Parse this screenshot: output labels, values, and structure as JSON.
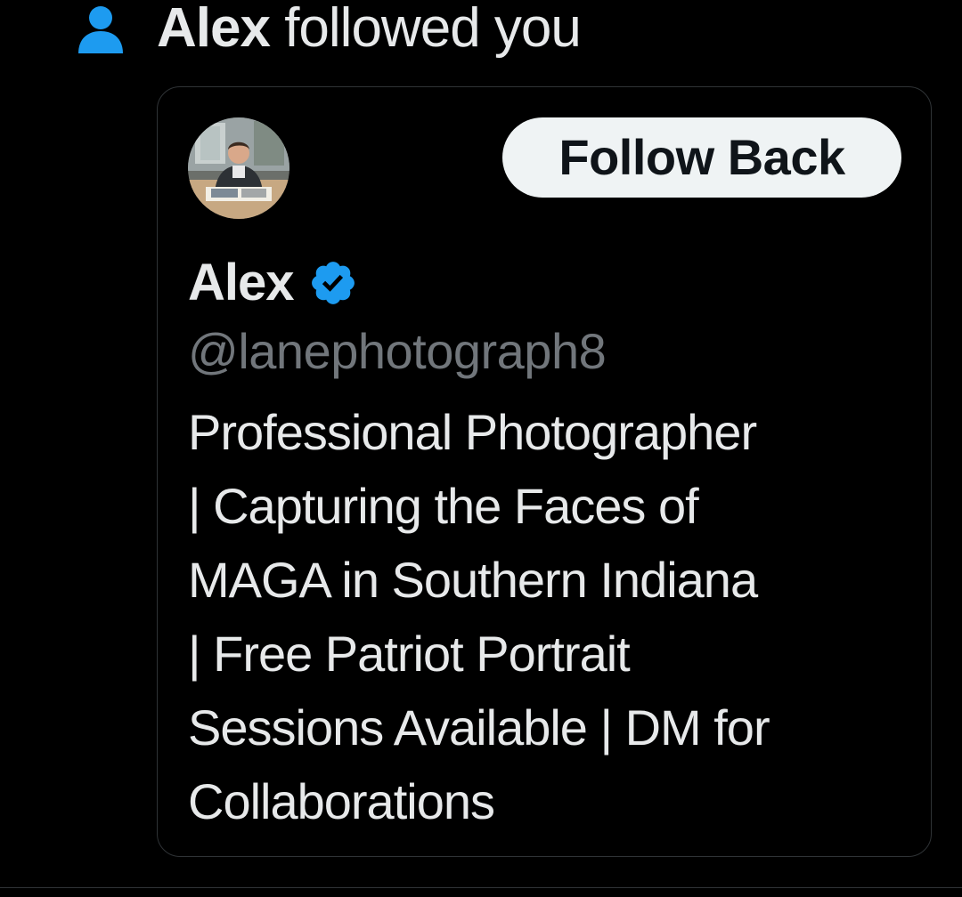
{
  "notification": {
    "icon": "person-icon",
    "actor_name": "Alex",
    "action_text": " followed you"
  },
  "card": {
    "avatar": "profile-photo",
    "follow_back_label": "Follow Back",
    "display_name": "Alex",
    "verified_icon": "verified-badge-icon",
    "handle": "@lanephotograph8",
    "bio_lines": [
      "Professional Photographer",
      "| Capturing the Faces of",
      "MAGA in Southern Indiana",
      "| Free Patriot Portrait",
      "Sessions Available | DM for",
      "Collaborations"
    ]
  },
  "colors": {
    "background": "#000000",
    "accent_blue": "#1d9bf0",
    "text_primary": "#e7e9ea",
    "text_secondary": "#71767b",
    "button_bg": "#eff3f4",
    "button_text": "#0f1419",
    "border": "#2f3336"
  }
}
